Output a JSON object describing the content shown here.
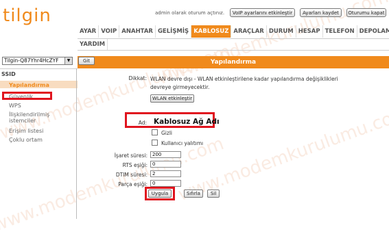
{
  "header": {
    "logo": "tilgin",
    "login_text": "admin olarak oturum açtınız.",
    "buttons": {
      "voip": "VoIP ayarlarını etkinleştir",
      "save": "Ayarları kaydet",
      "logout": "Oturumu kapat"
    }
  },
  "nav": {
    "row1": [
      "AYAR",
      "VOIP",
      "ANAHTAR",
      "GELİŞMİŞ",
      "KABLOSUZ",
      "ARAÇLAR",
      "DURUM",
      "HESAP",
      "TELEFON",
      "DEPOLAMA"
    ],
    "row2": [
      "YARDIM"
    ],
    "active": "KABLOSUZ"
  },
  "device": {
    "selected": "Tilgin-Q87Yhr4HcZYF",
    "go": "Git"
  },
  "page_title": "Yapılandırma",
  "sidebar": {
    "heading": "SSID",
    "items": [
      "Yapılandırma",
      "Güvenlik",
      "WPS",
      "İlişkilendirilmiş istemciler",
      "Erişim listesi",
      "Çoklu ortam"
    ]
  },
  "content": {
    "notice_label": "Dikkat:",
    "notice_text": "WLAN devre dışı - WLAN etkinleştirilene kadar yapılandırma değişiklikleri devreye girmeyecektir.",
    "enable_wlan": "WLAN etkinleştir",
    "ad_label": "Ad:",
    "ad_value": "Kablosuz Ağ Adı",
    "hidden_label": "Gizli",
    "isolation_label": "Kullanıcı yalıtımı",
    "beacon_label": "İşaret süresi:",
    "beacon_value": "200",
    "rts_label": "RTS eşiği:",
    "rts_value": "0",
    "dtim_label": "DTIM süresi:",
    "dtim_value": "2",
    "frag_label": "Parça eşiği:",
    "frag_value": "0",
    "apply": "Uygula",
    "reset": "Sıfırla",
    "delete": "Sil"
  },
  "watermark": "www.modemkurulumu.com"
}
